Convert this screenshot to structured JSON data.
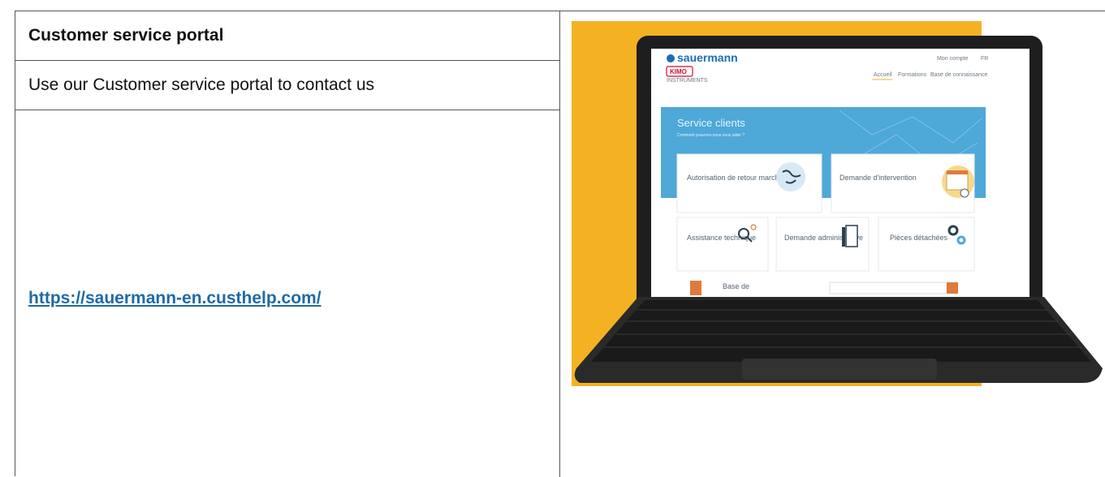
{
  "document": {
    "title": "Customer service portal",
    "description": "Use our Customer service portal to contact us",
    "link": "https://sauermann-en.custhelp.com/"
  },
  "laptop_screen": {
    "brand_primary": "sauermann",
    "brand_secondary": "KIMO",
    "brand_secondary_sub": "INSTRUMENTS",
    "top_links": [
      "Mon compte",
      "FR"
    ],
    "nav": [
      "Accueil",
      "Formations",
      "Base de connaissance"
    ],
    "hero_title": "Service clients",
    "hero_subtitle": "Comment pouvons-nous vous aider ?",
    "cards_large": [
      "Autorisation de retour marchandise",
      "Demande d'intervention"
    ],
    "cards_small": [
      "Assistance technique",
      "Demande administrative",
      "Pièces détachées"
    ],
    "bottom_partial": "Base de"
  },
  "colors": {
    "link": "#1f6aa5",
    "accent_yellow": "#f4b223",
    "hero_blue": "#4ea8d8",
    "brand_blue": "#1d6db5",
    "brand_red": "#c8102e"
  },
  "icons": [
    "globe-icon",
    "calendar-icon",
    "magnifier-icon",
    "document-icon",
    "gears-icon"
  ]
}
